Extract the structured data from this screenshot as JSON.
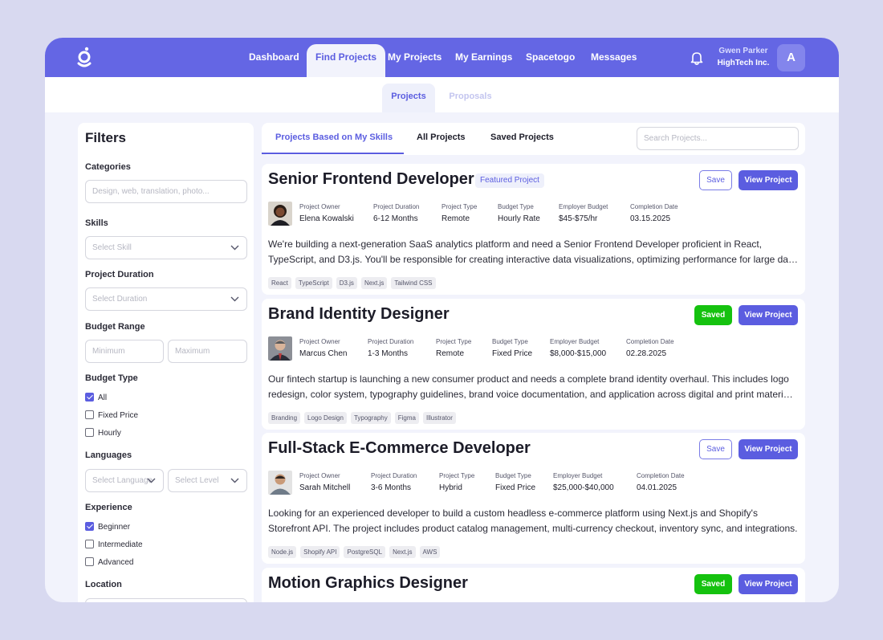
{
  "nav": {
    "items": [
      "Dashboard",
      "Find Projects",
      "My Projects",
      "My Earnings",
      "Spacetogo",
      "Messages"
    ],
    "active": "Find Projects",
    "user_name": "Gwen Parker",
    "user_company": "HighTech Inc.",
    "avatar_initial": "A"
  },
  "subtabs": {
    "projects": "Projects",
    "proposals": "Proposals"
  },
  "filters": {
    "title": "Filters",
    "categories_label": "Categories",
    "categories_placeholder": "Design, web, translation, photo...",
    "skills_label": "Skills",
    "skills_placeholder": "Select Skill",
    "duration_label": "Project Duration",
    "duration_placeholder": "Select Duration",
    "budget_label": "Budget Range",
    "budget_min": "Minimum",
    "budget_max": "Maximum",
    "budget_type_label": "Budget Type",
    "budget_types": [
      {
        "label": "All",
        "checked": true
      },
      {
        "label": "Fixed Price",
        "checked": false
      },
      {
        "label": "Hourly",
        "checked": false
      }
    ],
    "languages_label": "Languages",
    "language_placeholder": "Select Language",
    "level_placeholder": "Select Level",
    "experience_label": "Experience",
    "experience": [
      {
        "label": "Beginner",
        "checked": true
      },
      {
        "label": "Intermediate",
        "checked": false
      },
      {
        "label": "Advanced",
        "checked": false
      }
    ],
    "location_label": "Location"
  },
  "main_tabs": {
    "skills": "Projects Based on My Skills",
    "all": "All Projects",
    "saved": "Saved Projects",
    "search_placeholder": "Search Projects..."
  },
  "meta_labels": {
    "owner": "Project Owner",
    "duration": "Project Duration",
    "type": "Project Type",
    "budget_type": "Budget Type",
    "employer_budget": "Employer Budget",
    "completion": "Completion Date"
  },
  "buttons": {
    "save": "Save",
    "saved": "Saved",
    "view": "View Project"
  },
  "projects": [
    {
      "title": "Senior Frontend Developer",
      "badge": "Featured Project",
      "saved": false,
      "owner": "Elena Kowalski",
      "duration": "6-12 Months",
      "type": "Remote",
      "budget_type": "Hourly Rate",
      "employer_budget": "$45-$75/hr",
      "completion": "03.15.2025",
      "desc1": "We're building a next-generation SaaS analytics platform and need a Senior Frontend Developer proficient in React,",
      "desc2": "TypeScript, and D3.js. You'll be responsible for creating interactive data visualizations, optimizing performance for large data sets.",
      "tags": [
        "React",
        "TypeScript",
        "D3.js",
        "Next.js",
        "Tailwind CSS"
      ]
    },
    {
      "title": "Brand Identity Designer",
      "saved": true,
      "owner": "Marcus Chen",
      "duration": "1-3 Months",
      "type": "Remote",
      "budget_type": "Fixed Price",
      "employer_budget": "$8,000-$15,000",
      "completion": "02.28.2025",
      "desc1": "Our fintech startup is launching a new consumer product and needs a complete brand identity overhaul. This includes logo",
      "desc2": "redesign, color system, typography guidelines, brand voice documentation, and application across digital and print materials.",
      "tags": [
        "Branding",
        "Logo Design",
        "Typography",
        "Figma",
        "Illustrator"
      ]
    },
    {
      "title": "Full-Stack E-Commerce Developer",
      "saved": false,
      "owner": "Sarah Mitchell",
      "duration": "3-6 Months",
      "type": "Hybrid",
      "budget_type": "Fixed Price",
      "employer_budget": "$25,000-$40,000",
      "completion": "04.01.2025",
      "desc1": "Looking for an experienced developer to build a custom headless e-commerce platform using Next.js and Shopify's",
      "desc2": "Storefront API. The project includes product catalog management, multi-currency checkout, inventory sync, and integrations.",
      "tags": [
        "Node.js",
        "Shopify API",
        "PostgreSQL",
        "Next.js",
        "AWS"
      ]
    },
    {
      "title": "Motion Graphics Designer",
      "saved": true
    }
  ],
  "colors": {
    "primary": "#5b5de0",
    "nav": "#6466e4",
    "saved": "#15c20f"
  }
}
